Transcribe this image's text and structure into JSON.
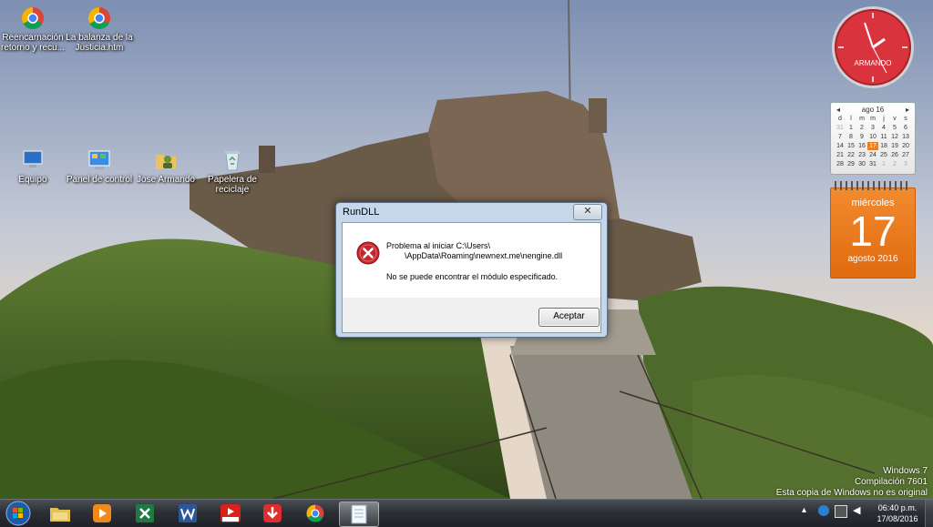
{
  "desktop": {
    "icons_top": [
      {
        "label": "Reencarnación retorno y recu...",
        "icon": "chrome-icon"
      },
      {
        "label": "La balanza de la Justicia.htm",
        "icon": "chrome-icon"
      }
    ],
    "icons_row": [
      {
        "label": "Equipo",
        "icon": "computer-icon"
      },
      {
        "label": "Panel de control",
        "icon": "control-panel-icon"
      },
      {
        "label": "Jose Armando",
        "icon": "user-folder-icon"
      },
      {
        "label": "Papelera de reciclaje",
        "icon": "recycle-bin-icon"
      }
    ]
  },
  "clock_gadget": {
    "label": "ARMANDO",
    "color": "#d9343d"
  },
  "calendar_gadget": {
    "month_label": "ago 16",
    "weekdays": [
      "d",
      "l",
      "m",
      "m",
      "j",
      "v",
      "s"
    ],
    "days": [
      [
        "31",
        "1",
        "2",
        "3",
        "4",
        "5",
        "6"
      ],
      [
        "7",
        "8",
        "9",
        "10",
        "11",
        "12",
        "13"
      ],
      [
        "14",
        "15",
        "16",
        "17",
        "18",
        "19",
        "20"
      ],
      [
        "21",
        "22",
        "23",
        "24",
        "25",
        "26",
        "27"
      ],
      [
        "28",
        "29",
        "30",
        "31",
        "1",
        "2",
        "3"
      ]
    ],
    "today": "17",
    "weekday_full": "miércoles",
    "big_day": "17",
    "month_year": "agosto 2016"
  },
  "dialog": {
    "title": "RunDLL",
    "close": "✕",
    "message_line1": "Problema al iniciar C:\\Users\\",
    "message_line2": "        \\AppData\\Roaming\\newnext.me\\nengine.dll",
    "message_detail": "No se puede encontrar el módulo especificado.",
    "ok_button": "Aceptar"
  },
  "watermark": {
    "line1": "Windows 7",
    "line2": "Compilación 7601",
    "line3": "Esta copia de Windows no es original"
  },
  "taskbar": {
    "pinned": [
      "start-orb",
      "explorer-icon",
      "media-player-icon",
      "excel-icon",
      "word-icon",
      "mp3-downloader-icon",
      "download-icon",
      "chrome-icon",
      "notepad-icon"
    ],
    "time": "06:40 p.m.",
    "date": "17/08/2016"
  }
}
